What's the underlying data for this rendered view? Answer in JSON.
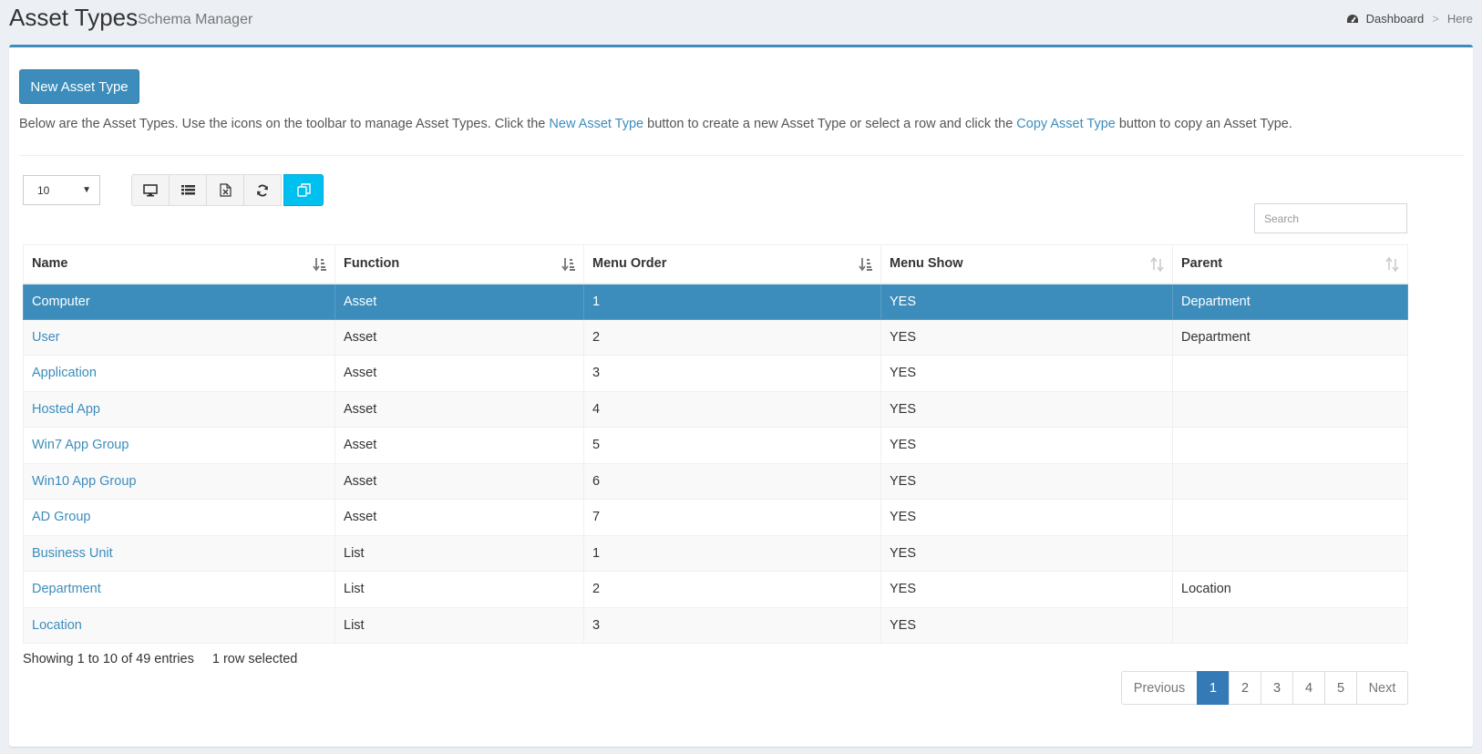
{
  "header": {
    "title": "Asset Types",
    "subtitle": "Schema Manager",
    "breadcrumb": {
      "home": "Dashboard",
      "separator": ">",
      "current": "Here"
    }
  },
  "actions": {
    "new_button": "New Asset Type"
  },
  "description": {
    "part1": "Below are the Asset Types. Use the icons on the toolbar to manage Asset Types. Click the ",
    "link1": "New Asset Type",
    "part2": " button to create a new Asset Type or select a row and click the ",
    "link2": "Copy Asset Type",
    "part3": " button to copy an Asset Type."
  },
  "toolbar": {
    "page_size": "10",
    "buttons": [
      "desktop-icon",
      "list-icon",
      "excel-icon",
      "refresh-icon",
      "copy-icon"
    ],
    "search_placeholder": "Search"
  },
  "table": {
    "columns": [
      "Name",
      "Function",
      "Menu Order",
      "Menu Show",
      "Parent"
    ],
    "rows": [
      {
        "name": "Computer",
        "function": "Asset",
        "menu_order": "1",
        "menu_show": "YES",
        "parent": "Department",
        "selected": true
      },
      {
        "name": "User",
        "function": "Asset",
        "menu_order": "2",
        "menu_show": "YES",
        "parent": "Department"
      },
      {
        "name": "Application",
        "function": "Asset",
        "menu_order": "3",
        "menu_show": "YES",
        "parent": ""
      },
      {
        "name": "Hosted App",
        "function": "Asset",
        "menu_order": "4",
        "menu_show": "YES",
        "parent": ""
      },
      {
        "name": "Win7 App Group",
        "function": "Asset",
        "menu_order": "5",
        "menu_show": "YES",
        "parent": ""
      },
      {
        "name": "Win10 App Group",
        "function": "Asset",
        "menu_order": "6",
        "menu_show": "YES",
        "parent": ""
      },
      {
        "name": "AD Group",
        "function": "Asset",
        "menu_order": "7",
        "menu_show": "YES",
        "parent": ""
      },
      {
        "name": "Business Unit",
        "function": "List",
        "menu_order": "1",
        "menu_show": "YES",
        "parent": ""
      },
      {
        "name": "Department",
        "function": "List",
        "menu_order": "2",
        "menu_show": "YES",
        "parent": "Location"
      },
      {
        "name": "Location",
        "function": "List",
        "menu_order": "3",
        "menu_show": "YES",
        "parent": ""
      }
    ]
  },
  "footer": {
    "info": "Showing 1 to 10 of 49 entries",
    "selected": "1 row selected"
  },
  "pagination": {
    "previous": "Previous",
    "pages": [
      "1",
      "2",
      "3",
      "4",
      "5"
    ],
    "active": "1",
    "next": "Next"
  },
  "colors": {
    "primary": "#3c8dbc",
    "info": "#00c0ef",
    "page_bg": "#ecf0f5",
    "active_page": "#337ab7"
  }
}
